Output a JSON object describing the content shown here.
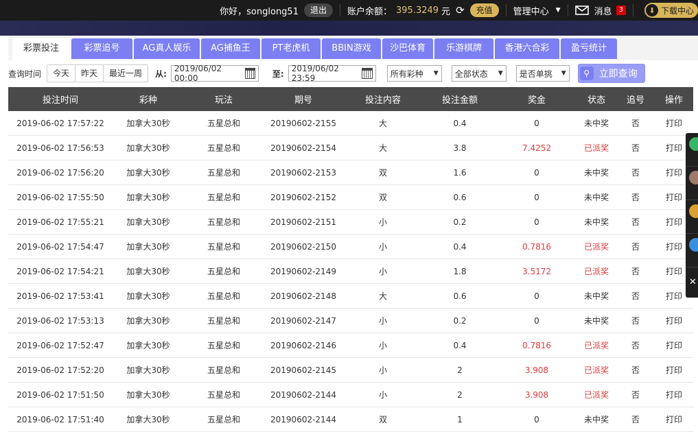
{
  "header": {
    "greeting": "你好，songlong51",
    "logout_label": "退出",
    "balance_label": "账户余额：",
    "balance_value": "395.3249",
    "balance_unit": "元",
    "recharge_label": "充值",
    "management_label": "管理中心",
    "messages_label": "消息",
    "messages_count": "3",
    "download_label": "下载中心"
  },
  "tabs": [
    {
      "label": "彩票投注",
      "active": true
    },
    {
      "label": "彩票追号"
    },
    {
      "label": "AG真人娱乐"
    },
    {
      "label": "AG捕鱼王"
    },
    {
      "label": "PT老虎机"
    },
    {
      "label": "BBIN游戏"
    },
    {
      "label": "沙巴体育"
    },
    {
      "label": "乐游棋牌"
    },
    {
      "label": "香港六合彩"
    },
    {
      "label": "盈亏统计"
    }
  ],
  "filters": {
    "query_time_label": "查询时间",
    "quick_today": "今天",
    "quick_yesterday": "昨天",
    "quick_week": "最近一周",
    "from_label": "从:",
    "from_value": "2019/06/02 00:00",
    "to_label": "至:",
    "to_value": "2019/06/02 23:59",
    "lottery_select": "所有彩种",
    "status_select": "全部状态",
    "single_select": "是否单挑",
    "search_label": "立即查询"
  },
  "table": {
    "columns": [
      "投注时间",
      "彩种",
      "玩法",
      "期号",
      "投注内容",
      "投注金额",
      "奖金",
      "状态",
      "追号",
      "操作"
    ],
    "rows": [
      [
        "2019-06-02 17:57:22",
        "加拿大30秒",
        "五星总和",
        "20190602-2155",
        "大",
        "0.4",
        "0",
        "未中奖",
        "否",
        "打印"
      ],
      [
        "2019-06-02 17:56:53",
        "加拿大30秒",
        "五星总和",
        "20190602-2154",
        "大",
        "3.8",
        "7.4252",
        "已派奖",
        "否",
        "打印"
      ],
      [
        "2019-06-02 17:56:20",
        "加拿大30秒",
        "五星总和",
        "20190602-2153",
        "双",
        "1.6",
        "0",
        "未中奖",
        "否",
        "打印"
      ],
      [
        "2019-06-02 17:55:50",
        "加拿大30秒",
        "五星总和",
        "20190602-2152",
        "双",
        "0.6",
        "0",
        "未中奖",
        "否",
        "打印"
      ],
      [
        "2019-06-02 17:55:21",
        "加拿大30秒",
        "五星总和",
        "20190602-2151",
        "小",
        "0.2",
        "0",
        "未中奖",
        "否",
        "打印"
      ],
      [
        "2019-06-02 17:54:47",
        "加拿大30秒",
        "五星总和",
        "20190602-2150",
        "小",
        "0.4",
        "0.7816",
        "已派奖",
        "否",
        "打印"
      ],
      [
        "2019-06-02 17:54:21",
        "加拿大30秒",
        "五星总和",
        "20190602-2149",
        "小",
        "1.8",
        "3.5172",
        "已派奖",
        "否",
        "打印"
      ],
      [
        "2019-06-02 17:53:41",
        "加拿大30秒",
        "五星总和",
        "20190602-2148",
        "大",
        "0.6",
        "0",
        "未中奖",
        "否",
        "打印"
      ],
      [
        "2019-06-02 17:53:13",
        "加拿大30秒",
        "五星总和",
        "20190602-2147",
        "小",
        "0.2",
        "0",
        "未中奖",
        "否",
        "打印"
      ],
      [
        "2019-06-02 17:52:47",
        "加拿大30秒",
        "五星总和",
        "20190602-2146",
        "小",
        "0.4",
        "0.7816",
        "已派奖",
        "否",
        "打印"
      ],
      [
        "2019-06-02 17:52:20",
        "加拿大30秒",
        "五星总和",
        "20190602-2145",
        "小",
        "2",
        "3.908",
        "已派奖",
        "否",
        "打印"
      ],
      [
        "2019-06-02 17:51:50",
        "加拿大30秒",
        "五星总和",
        "20190602-2144",
        "小",
        "2",
        "3.908",
        "已派奖",
        "否",
        "打印"
      ],
      [
        "2019-06-02 17:51:40",
        "加拿大30秒",
        "五星总和",
        "20190602-2144",
        "双",
        "1",
        "0",
        "未中奖",
        "否",
        "打印"
      ]
    ]
  },
  "colors": {
    "tab_bg": "#7b7ff2",
    "header_bg": "#1b1b1b",
    "gold": "#d8b55a",
    "won_red": "#e03c3c"
  }
}
